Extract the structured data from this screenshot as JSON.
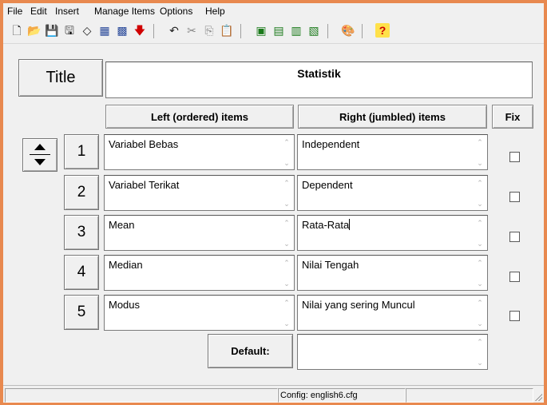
{
  "menubar": {
    "items": [
      "File",
      "Edit",
      "Insert",
      "Manage Items",
      "Options",
      "Help"
    ]
  },
  "toolbar": {
    "icons": [
      "new-icon",
      "open-icon",
      "save-icon",
      "save-as-icon",
      "erase-icon",
      "export-icon",
      "export-alt-icon",
      "download-icon",
      "undo-icon",
      "cut-icon",
      "copy-icon",
      "paste-icon",
      "web-icon",
      "tree-icon",
      "shuffle-icon",
      "properties-icon",
      "palette-icon",
      "help-icon"
    ]
  },
  "title": {
    "button_label": "Title",
    "value": "Statistik"
  },
  "headers": {
    "left": "Left (ordered) items",
    "right": "Right (jumbled) items",
    "fix": "Fix"
  },
  "rows": [
    {
      "num": "1",
      "left": "Variabel Bebas",
      "right": "Independent",
      "fix": false
    },
    {
      "num": "2",
      "left": "Variabel Terikat",
      "right": "Dependent",
      "fix": false
    },
    {
      "num": "3",
      "left": "Mean",
      "right": "Rata-Rata",
      "fix": false
    },
    {
      "num": "4",
      "left": "Median",
      "right": "Nilai Tengah",
      "fix": false
    },
    {
      "num": "5",
      "left": "Modus",
      "right": "Nilai yang sering Muncul",
      "fix": false
    }
  ],
  "default": {
    "label": "Default:",
    "value": ""
  },
  "status": {
    "left": "",
    "config": "Config: english6.cfg",
    "right": ""
  },
  "colors": {
    "frame": "#e8894f",
    "window": "#f0f0f0"
  }
}
